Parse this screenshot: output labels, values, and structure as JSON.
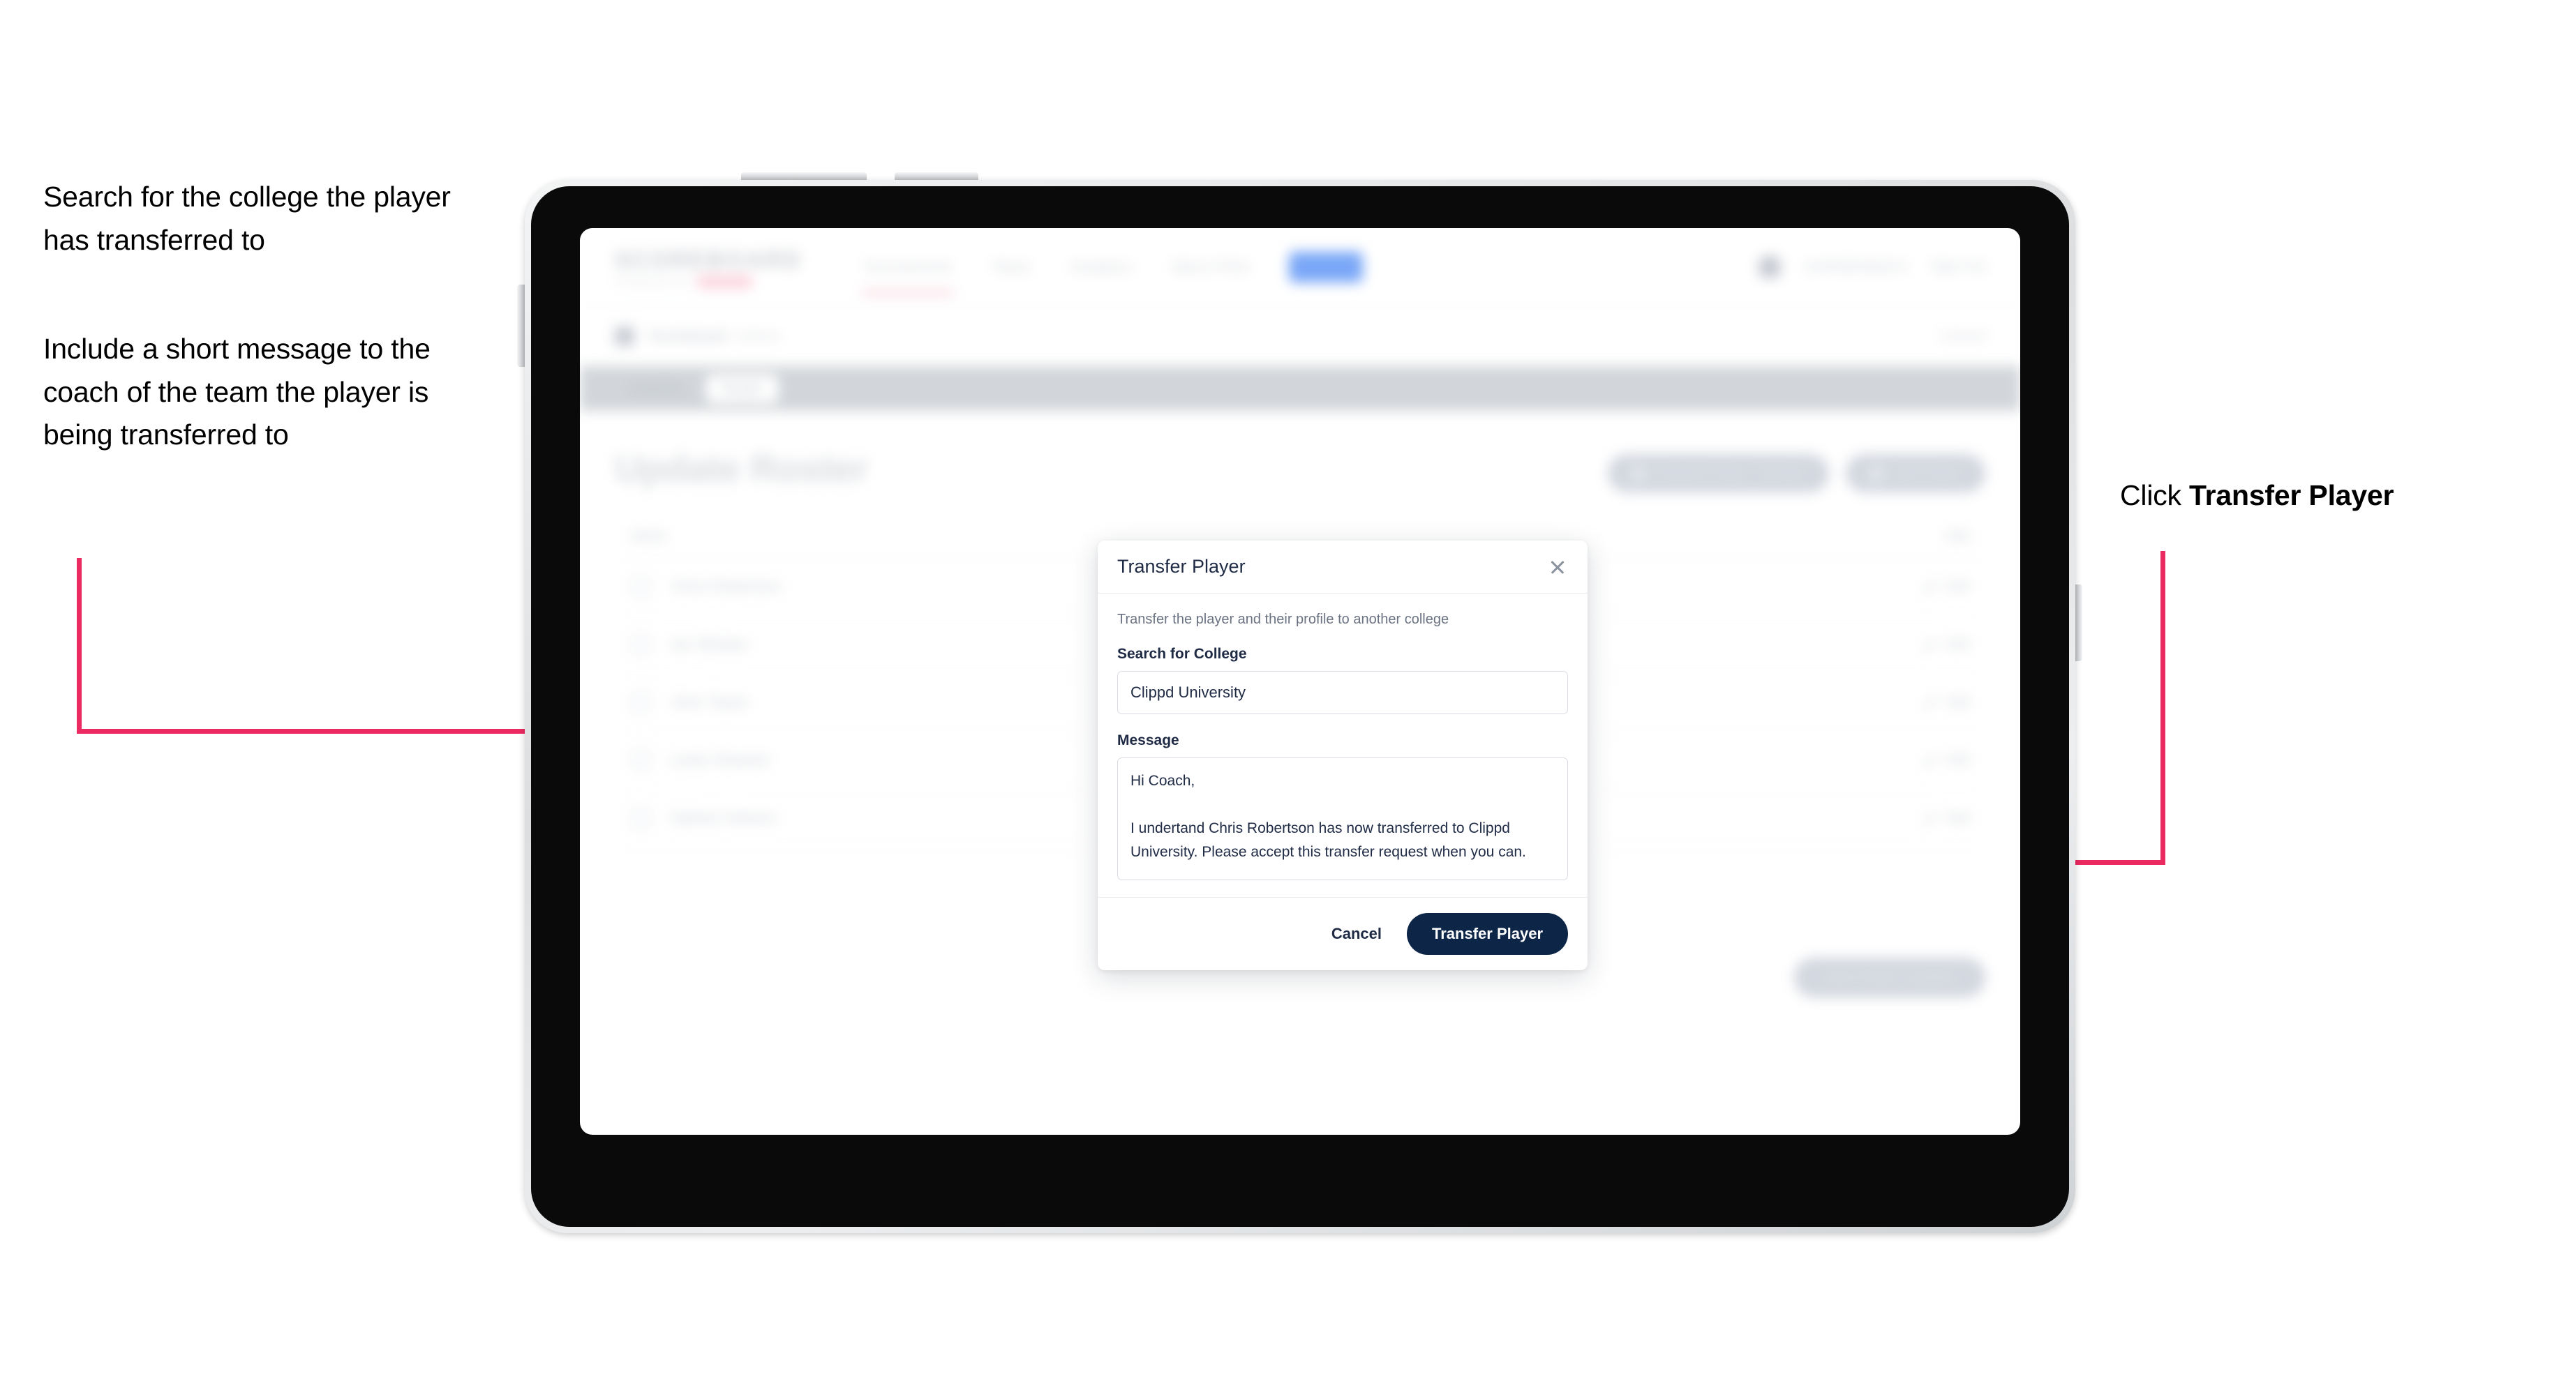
{
  "annotations": {
    "left_1": "Search for the college the player has transferred to",
    "left_2": "Include a short message to the coach of the team the player is being transferred to",
    "right_prefix": "Click ",
    "right_bold": "Transfer Player",
    "arrow_color": "#EC2A62"
  },
  "app": {
    "navbar": {
      "logo": "SCOREBOARD",
      "logo_sub": "POWERED BY",
      "logo_badge": "CLIPPD",
      "links": [
        {
          "label": "Tournaments"
        },
        {
          "label": "Team"
        },
        {
          "label": "Analytics"
        },
        {
          "label": "Men's PGA"
        },
        {
          "label": "Admin"
        }
      ],
      "email": "jsmith@clippd.io",
      "sign_out": "Sign Out"
    },
    "breadcrumb": {
      "icon": "board-icon",
      "main": "Scoreboard",
      "sub": "Admin",
      "right": "Cancel"
    },
    "tabs": [
      {
        "label": "Coaches",
        "active": false
      },
      {
        "label": "Roster",
        "active": true
      }
    ],
    "page": {
      "title": "Update Roster",
      "actions": [
        {
          "label": "Request Player Transfer",
          "icon": "transfer-icon"
        },
        {
          "label": "Add Player",
          "icon": "plus-icon"
        }
      ],
      "list_header": {
        "name": "Name",
        "edit": "Edit"
      },
      "rows": [
        {
          "name": "Chris Robertson",
          "edit": "Edit"
        },
        {
          "name": "Ian Whelan",
          "edit": "Edit"
        },
        {
          "name": "John Taylor",
          "edit": "Edit"
        },
        {
          "name": "Lewis Shackel",
          "edit": "Edit"
        },
        {
          "name": "Nathan Holmes",
          "edit": "Edit"
        }
      ],
      "footer_action": "Save Roster Updates"
    }
  },
  "modal": {
    "title": "Transfer Player",
    "close_icon": "close-icon",
    "description": "Transfer the player and their profile to another college",
    "search_label": "Search for College",
    "search_value": "Clippd University",
    "search_placeholder": "Search for College",
    "message_label": "Message",
    "message_value": "Hi Coach,\n\nI undertand Chris Robertson has now transferred to Clippd University. Please accept this transfer request when you can.",
    "message_placeholder": "Message",
    "cancel_label": "Cancel",
    "submit_label": "Transfer Player",
    "submit_color": "#0d2648"
  }
}
